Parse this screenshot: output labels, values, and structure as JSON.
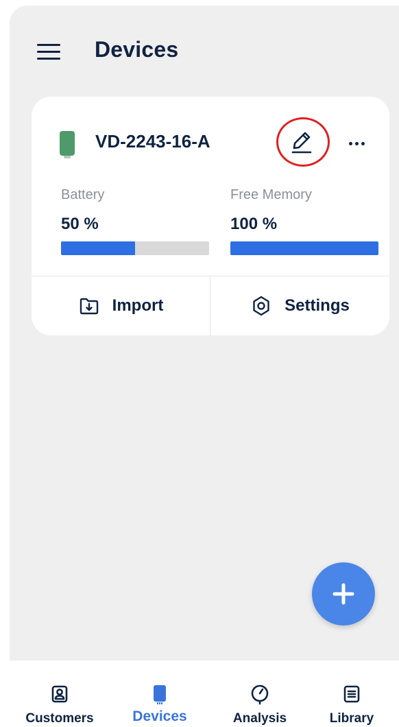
{
  "header": {
    "title": "Devices",
    "menu_icon": "hamburger-menu-icon"
  },
  "device_card": {
    "name": "VD-2243-16-A",
    "device_icon_color": "#4f9a6a",
    "edit_icon": "pencil-icon",
    "more_icon": "more-horizontal-icon",
    "highlight_color": "#e02020",
    "battery": {
      "label": "Battery",
      "value": "50 %",
      "level": 0.5
    },
    "memory": {
      "label": "Free Memory",
      "value": "100 %",
      "level": 1.0
    },
    "actions": {
      "import_label": "Import",
      "import_icon": "folder-download-icon",
      "settings_label": "Settings",
      "settings_icon": "gear-icon"
    }
  },
  "fab": {
    "icon": "plus-icon",
    "color": "#4a86e8"
  },
  "bottom_nav": {
    "active_color": "#3b74d9",
    "items": [
      {
        "label": "Customers",
        "icon": "contact-card-icon"
      },
      {
        "label": "Devices",
        "icon": "device-icon",
        "active": true
      },
      {
        "label": "Analysis",
        "icon": "gauge-icon"
      },
      {
        "label": "Library",
        "icon": "document-list-icon"
      }
    ]
  }
}
